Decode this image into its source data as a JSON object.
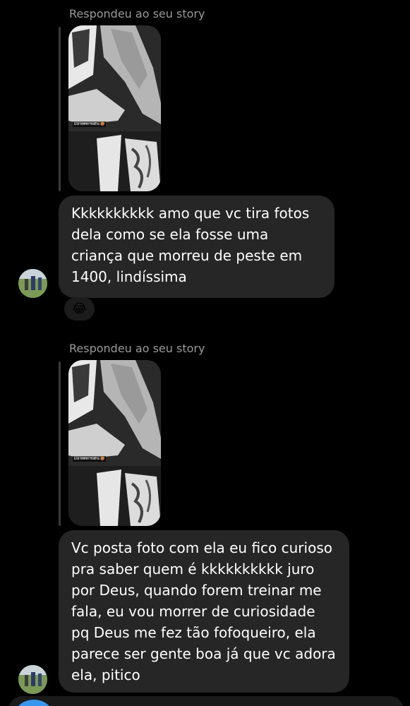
{
  "messages": [
    {
      "reply_label": "Respondeu ao seu story",
      "story_caption": "Ela como malha 🥵",
      "text": "Kkkkkkkkkk amo que vc tira fotos dela como se ela fosse uma criança que morreu de peste em 1400, lindíssima",
      "reaction": "😂"
    },
    {
      "reply_label": "Respondeu ao seu story",
      "story_caption": "Ela como malha 🥵",
      "text": "Vc posta foto com ela eu fico curioso pra saber quem é kkkkkkkkkk juro por Deus, quando forem treinar me fala, eu vou morrer de curiosidade pq Deus me fez tão fofoqueiro, ela parece ser gente boa já que vc adora ela, pitico"
    }
  ],
  "composer": {
    "camera_icon": "camera-icon"
  }
}
